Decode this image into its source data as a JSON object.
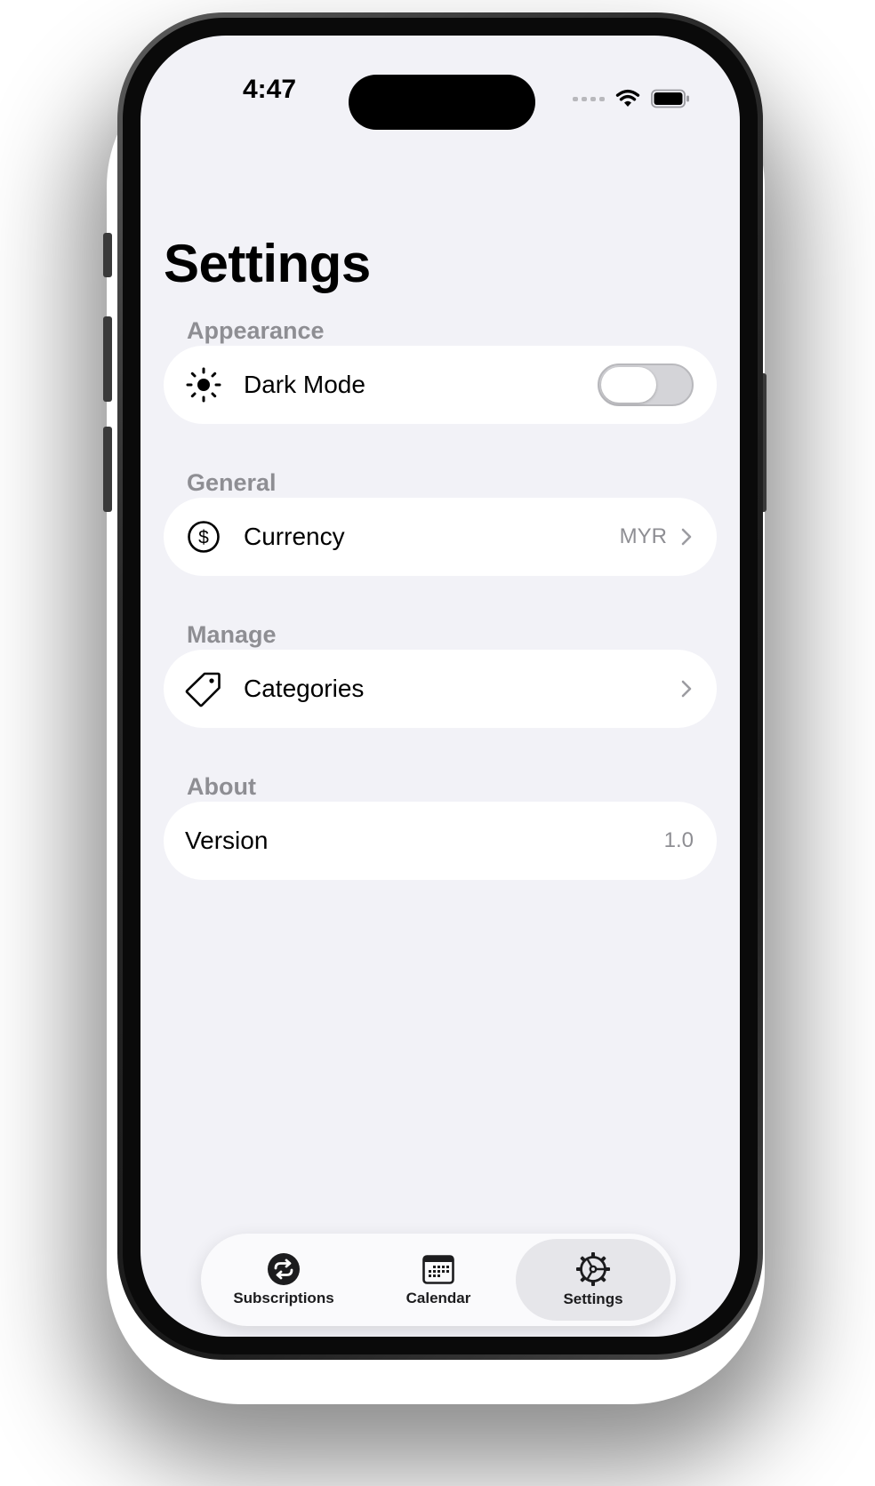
{
  "status_bar": {
    "time": "4:47"
  },
  "header": {
    "title": "Settings"
  },
  "sections": {
    "appearance": {
      "label": "Appearance",
      "dark_mode": {
        "label": "Dark Mode",
        "enabled": false,
        "icon": "sun-icon"
      }
    },
    "general": {
      "label": "General",
      "currency": {
        "label": "Currency",
        "value": "MYR",
        "icon": "dollar-circle-icon"
      }
    },
    "manage": {
      "label": "Manage",
      "categories": {
        "label": "Categories",
        "icon": "tag-icon"
      }
    },
    "about": {
      "label": "About",
      "version": {
        "label": "Version",
        "value": "1.0"
      }
    }
  },
  "tab_bar": {
    "tabs": [
      {
        "label": "Subscriptions",
        "icon": "repeat-circle-icon",
        "active": false
      },
      {
        "label": "Calendar",
        "icon": "calendar-icon",
        "active": false
      },
      {
        "label": "Settings",
        "icon": "gear-icon",
        "active": true
      }
    ]
  },
  "colors": {
    "background": "#f2f2f7",
    "card": "#ffffff",
    "secondary_text": "#8e8e93",
    "tab_active": "#e6e6ea"
  }
}
